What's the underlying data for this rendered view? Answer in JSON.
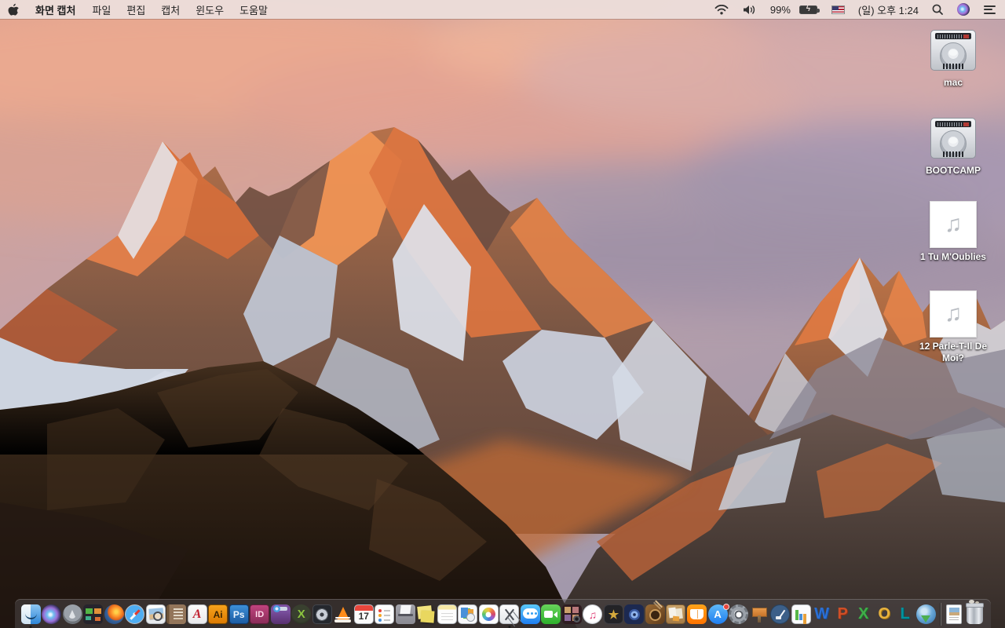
{
  "menu_bar": {
    "apple_menu_icon": "apple-logo",
    "app_menus": [
      {
        "label": "화면 캡처",
        "bold": true
      },
      {
        "label": "파일",
        "bold": false
      },
      {
        "label": "편집",
        "bold": false
      },
      {
        "label": "캡처",
        "bold": false
      },
      {
        "label": "윈도우",
        "bold": false
      },
      {
        "label": "도움말",
        "bold": false
      }
    ],
    "status": {
      "battery_percent": "99%",
      "battery_charging": true,
      "input_source": "us-flag",
      "clock": "(일) 오후 1:24"
    },
    "status_icons": [
      "wifi-icon",
      "volume-icon",
      "battery-icon",
      "input-source-flag",
      "spotlight-icon",
      "siri-icon",
      "notification-center-icon"
    ]
  },
  "desktop": {
    "icons": [
      {
        "id": "mac",
        "label": "mac",
        "type": "hard-drive"
      },
      {
        "id": "bootcamp",
        "label": "BOOTCAMP",
        "type": "hard-drive"
      },
      {
        "id": "song-1",
        "label": "1 Tu M'Oublies",
        "type": "audio-file"
      },
      {
        "id": "song-12",
        "label": "12 Parle-T-Il De Moi?",
        "type": "audio-file"
      }
    ]
  },
  "dock": {
    "items": [
      {
        "id": "finder",
        "name": "finder-icon",
        "running": true
      },
      {
        "id": "siri",
        "name": "siri-icon"
      },
      {
        "id": "launchpad",
        "name": "launchpad-icon"
      },
      {
        "id": "mission-control",
        "name": "mission-control-icon"
      },
      {
        "id": "firefox",
        "name": "firefox-icon"
      },
      {
        "id": "safari",
        "name": "safari-icon"
      },
      {
        "id": "preview",
        "name": "preview-icon"
      },
      {
        "id": "contacts",
        "name": "contacts-icon"
      },
      {
        "id": "acrobat-reader",
        "name": "acrobat-reader-icon",
        "glyph": "A"
      },
      {
        "id": "illustrator",
        "name": "illustrator-icon",
        "glyph": "Ai"
      },
      {
        "id": "photoshop",
        "name": "photoshop-icon",
        "glyph": "Ps"
      },
      {
        "id": "indesign",
        "name": "indesign-icon",
        "glyph": "ID"
      },
      {
        "id": "toast",
        "name": "toast-icon"
      },
      {
        "id": "x-media",
        "name": "x-media-app-icon",
        "glyph": "X"
      },
      {
        "id": "disk-tool",
        "name": "disk-tool-icon"
      },
      {
        "id": "vlc",
        "name": "vlc-icon"
      },
      {
        "id": "calendar",
        "name": "calendar-icon",
        "glyph": "17"
      },
      {
        "id": "reminders",
        "name": "reminders-icon"
      },
      {
        "id": "doc-box",
        "name": "document-box-app-icon"
      },
      {
        "id": "stickies",
        "name": "stickies-icon"
      },
      {
        "id": "notes",
        "name": "notes-icon"
      },
      {
        "id": "templates",
        "name": "templates-app-icon"
      },
      {
        "id": "photos",
        "name": "photos-icon"
      },
      {
        "id": "screen-capture",
        "name": "screen-capture-grab-icon",
        "running": true
      },
      {
        "id": "messages",
        "name": "messages-icon"
      },
      {
        "id": "facetime",
        "name": "facetime-icon"
      },
      {
        "id": "photo-booth",
        "name": "photo-booth-icon"
      },
      {
        "id": "itunes",
        "name": "itunes-icon",
        "glyph": "♫"
      },
      {
        "id": "imovie",
        "name": "imovie-icon",
        "glyph": "★"
      },
      {
        "id": "idvd",
        "name": "idvd-icon"
      },
      {
        "id": "garageband",
        "name": "garageband-icon"
      },
      {
        "id": "news-board",
        "name": "news-board-app-icon"
      },
      {
        "id": "ibooks",
        "name": "ibooks-icon"
      },
      {
        "id": "app-store",
        "name": "app-store-icon",
        "glyph": "A",
        "badge_dot": true
      },
      {
        "id": "system-preferences",
        "name": "system-preferences-icon"
      },
      {
        "id": "keynote",
        "name": "keynote-icon"
      },
      {
        "id": "pages",
        "name": "pages-icon"
      },
      {
        "id": "numbers",
        "name": "numbers-icon"
      },
      {
        "id": "word",
        "name": "microsoft-word-icon",
        "glyph": "W"
      },
      {
        "id": "powerpoint",
        "name": "microsoft-powerpoint-icon",
        "glyph": "P"
      },
      {
        "id": "excel",
        "name": "microsoft-excel-icon",
        "glyph": "X"
      },
      {
        "id": "outlook",
        "name": "microsoft-outlook-icon",
        "glyph": "O"
      },
      {
        "id": "lync",
        "name": "microsoft-lync-icon",
        "glyph": "L"
      },
      {
        "id": "downloader",
        "name": "download-manager-icon"
      },
      {
        "id": "separator",
        "name": "dock-separator"
      },
      {
        "id": "document-file",
        "name": "document-file-icon"
      },
      {
        "id": "trash",
        "name": "trash-icon"
      }
    ]
  },
  "colors": {
    "menubar_bg": "#ecdedb",
    "dock_bg_rgba": "rgba(78,72,74,0.52)",
    "label_text": "#ffffff",
    "badge_red": "#e8463c",
    "sky_pink": "#e2a18d",
    "sky_purple": "#9e95ab",
    "mountain_orange": "#d97a42",
    "rock_dark": "#2a1d14"
  }
}
